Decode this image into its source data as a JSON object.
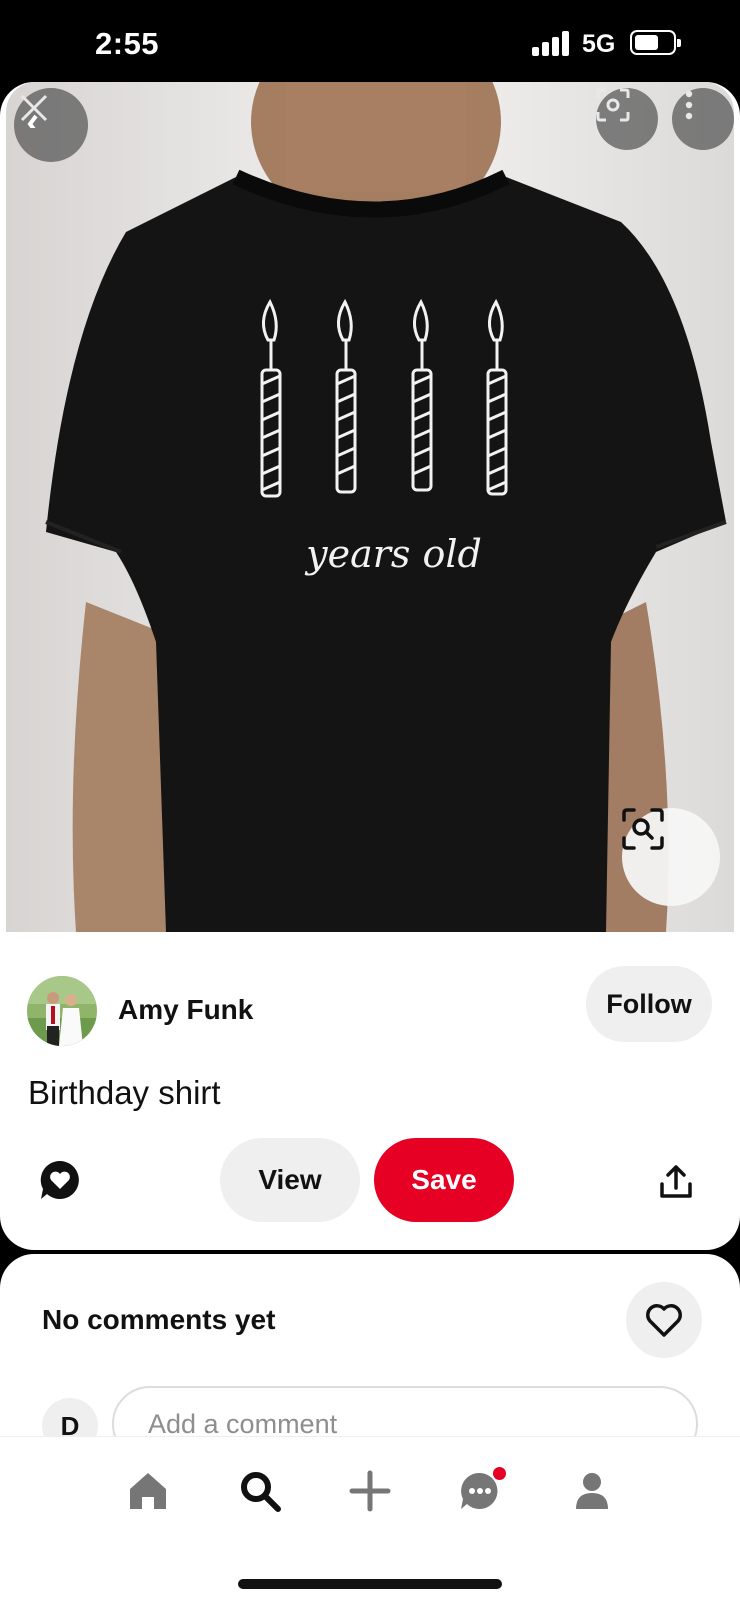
{
  "status_bar": {
    "time": "2:55",
    "network": "5G",
    "battery_level": 0.65
  },
  "pin": {
    "image_alt": "Black shirt with candles",
    "shirt_text": "years old",
    "creator": {
      "name": "Amy Funk",
      "follow_label": "Follow"
    },
    "title": "Birthday shirt",
    "actions": {
      "view_label": "View",
      "save_label": "Save"
    }
  },
  "comments": {
    "header": "No comments yet",
    "user_initial": "D",
    "placeholder": "Add a comment"
  },
  "nav": {
    "items": [
      "home",
      "search",
      "create",
      "messages",
      "profile"
    ],
    "messages_has_notification": true
  },
  "colors": {
    "brand_red": "#e60023",
    "button_gray": "#efefef"
  }
}
